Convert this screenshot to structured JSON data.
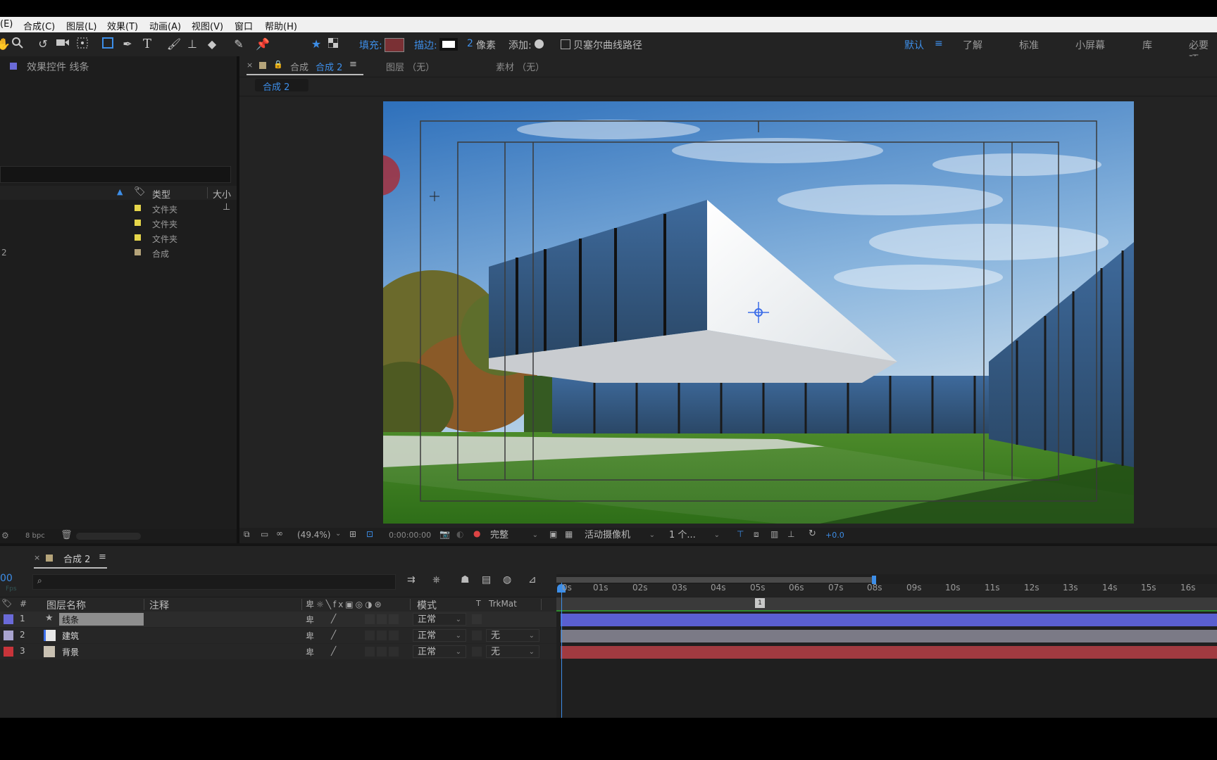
{
  "menu": [
    "(E)",
    "合成(C)",
    "图层(L)",
    "效果(T)",
    "动画(A)",
    "视图(V)",
    "窗口",
    "帮助(H)"
  ],
  "toolbar": {
    "fill_label": "填充:",
    "stroke_label": "描边:",
    "stroke_width": "2",
    "stroke_unit": "像素",
    "add_label": "添加:",
    "bezier_label": "贝塞尔曲线路径",
    "workspaces": [
      "默认",
      "了解",
      "标准",
      "小屏幕",
      "库",
      "必要项"
    ]
  },
  "effects_panel": {
    "title": "效果控件 线条"
  },
  "project": {
    "col_type": "类型",
    "col_size": "大小",
    "rows": [
      {
        "prefix": "",
        "type": "文件夹",
        "color": "#e6d64a"
      },
      {
        "prefix": "",
        "type": "文件夹",
        "color": "#e6d64a"
      },
      {
        "prefix": "",
        "type": "文件夹",
        "color": "#e6d64a"
      },
      {
        "prefix": "2",
        "type": "合成",
        "color": "#b5a47a"
      }
    ],
    "bpc": "8 bpc"
  },
  "comp_tabs": {
    "comp_tab_prefix": "合成",
    "comp_tab_name": "合成 2",
    "layer_tab": "图层 （无）",
    "footage_tab": "素材 （无）",
    "breadcrumb": "合成 2"
  },
  "viewer_bar": {
    "zoom": "(49.4%)",
    "timecode": "0:00:00:00",
    "quality": "完整",
    "camera": "活动摄像机",
    "views": "1 个...",
    "exposure": "+0.0"
  },
  "timeline": {
    "tab_name": "合成 2",
    "current_time": "00",
    "fps_hint": "Fps",
    "col_num": "#",
    "col_layer_name": "图层名称",
    "col_comment": "注释",
    "col_mode": "模式",
    "col_t": "T",
    "col_trkmat": "TrkMat",
    "ruler": [
      "0s",
      "01s",
      "02s",
      "03s",
      "04s",
      "05s",
      "06s",
      "07s",
      "08s",
      "09s",
      "10s",
      "11s",
      "12s",
      "13s",
      "14s",
      "15s",
      "16s"
    ],
    "layers": [
      {
        "index": "1",
        "name": "线条",
        "mode": "正常",
        "trkmat": "",
        "label_color": "#6a6ad8",
        "bar_color": "#5a5fd0"
      },
      {
        "index": "2",
        "name": "建筑",
        "mode": "正常",
        "trkmat": "无",
        "label_color": "#a9a4cf",
        "bar_color": "#7b7a86"
      },
      {
        "index": "3",
        "name": "背景",
        "mode": "正常",
        "trkmat": "无",
        "label_color": "#c8343a",
        "bar_color": "#a13a40"
      }
    ]
  }
}
